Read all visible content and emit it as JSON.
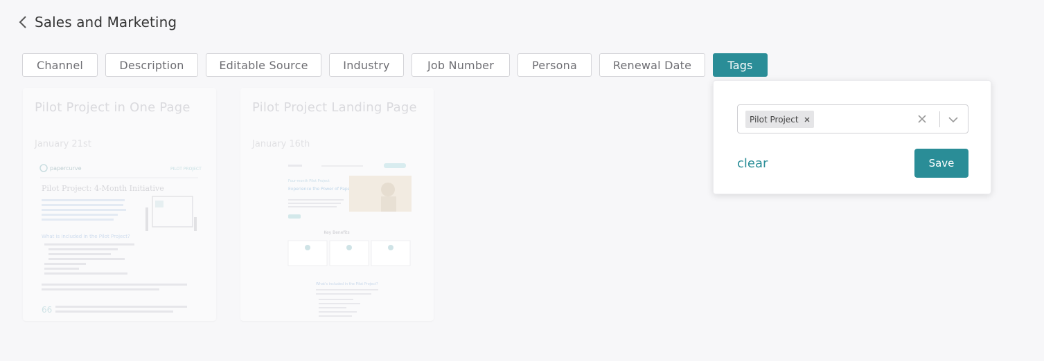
{
  "header": {
    "title": "Sales and Marketing",
    "back_icon": "chevron-left-icon"
  },
  "filters": [
    {
      "label": "Channel",
      "active": false
    },
    {
      "label": "Description",
      "active": false
    },
    {
      "label": "Editable Source",
      "active": false
    },
    {
      "label": "Industry",
      "active": false
    },
    {
      "label": "Job Number",
      "active": false
    },
    {
      "label": "Persona",
      "active": false
    },
    {
      "label": "Renewal Date",
      "active": false
    },
    {
      "label": "Tags",
      "active": true
    }
  ],
  "cards": [
    {
      "title": "Pilot Project in One Page",
      "date": "January 21st",
      "thumb": {
        "brand": "papercurve",
        "tag": "PILOT PROJECT",
        "heading": "Pilot Project: 4-Month Initiative",
        "section": "What is included in the Pilot Project?"
      }
    },
    {
      "title": "Pilot Project Landing Page",
      "date": "January 16th",
      "thumb": {
        "eyebrow": "Four-month Pilot Project",
        "hero": "Experience the Power of Papercurve",
        "benefits": "Key Benefits",
        "section": "What's included in the Pilot Project?"
      }
    }
  ],
  "tag_popover": {
    "selected_tags": [
      "Pilot Project"
    ],
    "clear_label": "clear",
    "save_label": "Save"
  },
  "colors": {
    "accent": "#2a8d97",
    "background": "#f7f7f9"
  }
}
